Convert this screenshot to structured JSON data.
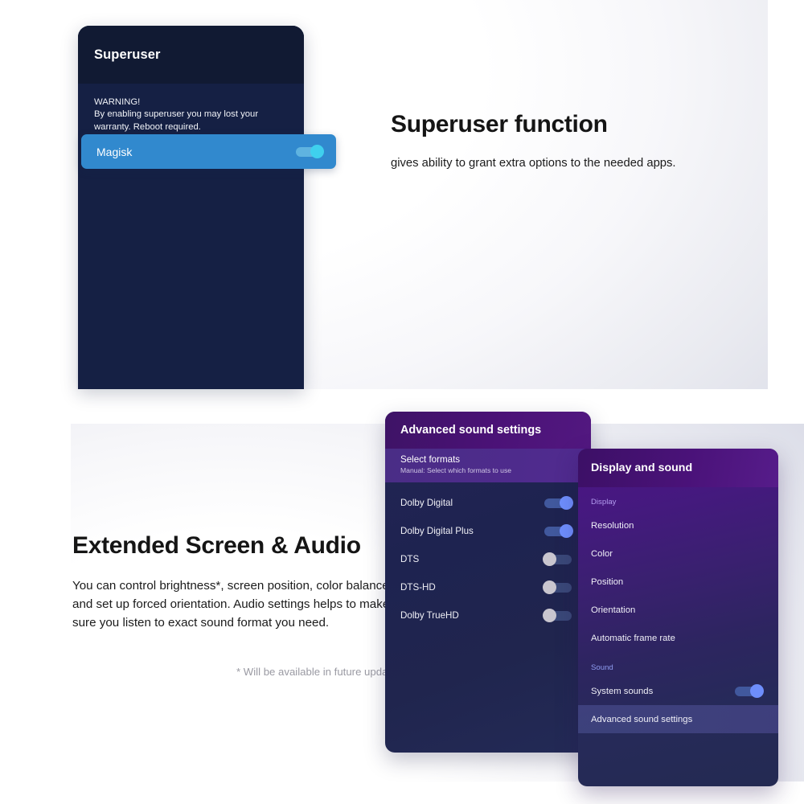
{
  "top_section": {
    "phone": {
      "header_title": "Superuser",
      "warning_title": "WARNING!",
      "warning_body": "By enabling superuser you may lost your warranty. Reboot required.",
      "row": {
        "label": "Magisk",
        "toggle_state": "on",
        "toggle_icon": "toggle-on-icon"
      }
    },
    "heading": "Superuser function",
    "subheading": "gives ability to grant extra options to the needed apps."
  },
  "bottom_section": {
    "heading": "Extended Screen & Audio",
    "paragraph": "You can control brightness*, screen position, color balance and set up forced orientation. Audio settings helps to make sure you listen to exact sound format you need.",
    "footnote": "* Will be available in future updates",
    "sound_panel": {
      "title": "Advanced sound settings",
      "select_formats": {
        "title": "Select formats",
        "subtitle": "Manual: Select which formats to use"
      },
      "formats": [
        {
          "label": "Dolby Digital",
          "state": "on"
        },
        {
          "label": "Dolby Digital Plus",
          "state": "on"
        },
        {
          "label": "DTS",
          "state": "off"
        },
        {
          "label": "DTS-HD",
          "state": "off"
        },
        {
          "label": "Dolby TrueHD",
          "state": "off"
        }
      ]
    },
    "display_panel": {
      "title": "Display and sound",
      "display_group_label": "Display",
      "display_items": [
        {
          "label": "Resolution"
        },
        {
          "label": "Color"
        },
        {
          "label": "Position"
        },
        {
          "label": "Orientation"
        },
        {
          "label": "Automatic frame rate"
        }
      ],
      "sound_group_label": "Sound",
      "sound_items": [
        {
          "label": "System sounds",
          "state": "on"
        },
        {
          "label": "Advanced sound settings",
          "highlighted": true
        }
      ]
    }
  },
  "colors": {
    "phone_card_bg": "#152044",
    "phone_header_bg": "#111a33",
    "magisk_row_bg": "#3189ce",
    "magisk_thumb": "#3fd0ee",
    "purple_header": "#4b1277",
    "toggle_on_thumb": "#6e8efc",
    "toggle_off_thumb": "#c9c6cf",
    "heading_text": "#151515",
    "footnote_text": "#9a9aa3"
  }
}
